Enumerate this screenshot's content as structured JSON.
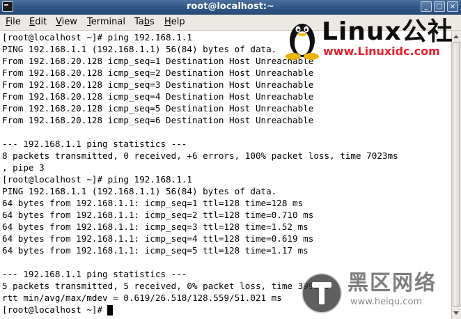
{
  "window": {
    "title": "root@localhost:~",
    "minimize_glyph": "_",
    "maximize_glyph": "□",
    "close_glyph": "×"
  },
  "menu": [
    {
      "label": "File",
      "mnemonic": "F",
      "rest": "ile"
    },
    {
      "label": "Edit",
      "mnemonic": "E",
      "rest": "dit"
    },
    {
      "label": "View",
      "mnemonic": "V",
      "rest": "iew"
    },
    {
      "label": "Terminal",
      "mnemonic": "T",
      "rest": "erminal"
    },
    {
      "label": "Tabs",
      "prefix": "Ta",
      "mnemonic": "b",
      "rest": "s"
    },
    {
      "label": "Help",
      "mnemonic": "H",
      "rest": "elp"
    }
  ],
  "terminal": {
    "lines": [
      "[root@localhost ~]# ping 192.168.1.1",
      "PING 192.168.1.1 (192.168.1.1) 56(84) bytes of data.",
      "From 192.168.20.128 icmp_seq=1 Destination Host Unreachable",
      "From 192.168.20.128 icmp_seq=2 Destination Host Unreachable",
      "From 192.168.20.128 icmp_seq=3 Destination Host Unreachable",
      "From 192.168.20.128 icmp_seq=4 Destination Host Unreachable",
      "From 192.168.20.128 icmp_seq=5 Destination Host Unreachable",
      "From 192.168.20.128 icmp_seq=6 Destination Host Unreachable",
      "",
      "--- 192.168.1.1 ping statistics ---",
      "8 packets transmitted, 0 received, +6 errors, 100% packet loss, time 7023ms",
      ", pipe 3",
      "[root@localhost ~]# ping 192.168.1.1",
      "PING 192.168.1.1 (192.168.1.1) 56(84) bytes of data.",
      "64 bytes from 192.168.1.1: icmp_seq=1 ttl=128 time=128 ms",
      "64 bytes from 192.168.1.1: icmp_seq=2 ttl=128 time=0.710 ms",
      "64 bytes from 192.168.1.1: icmp_seq=3 ttl=128 time=1.52 ms",
      "64 bytes from 192.168.1.1: icmp_seq=4 ttl=128 time=0.619 ms",
      "64 bytes from 192.168.1.1: icmp_seq=5 ttl=128 time=1.17 ms",
      "",
      "--- 192.168.1.1 ping statistics ---",
      "5 packets transmitted, 5 received, 0% packet loss, time 3999ms",
      "rtt min/avg/max/mdev = 0.619/26.518/128.559/51.021 ms",
      "[root@localhost ~]# "
    ]
  },
  "watermarks": {
    "linux_word": "Linux公社",
    "linux_url": "www.Linuxidc.com",
    "heiqu_word": "黑区网络",
    "heiqu_url": "www.heiqu.com"
  },
  "colors": {
    "titlebar": "#2f5687",
    "menubar": "#ece9e4",
    "terminal_bg": "#ffffff",
    "terminal_fg": "#000000",
    "linux_url": "#e8202a"
  }
}
